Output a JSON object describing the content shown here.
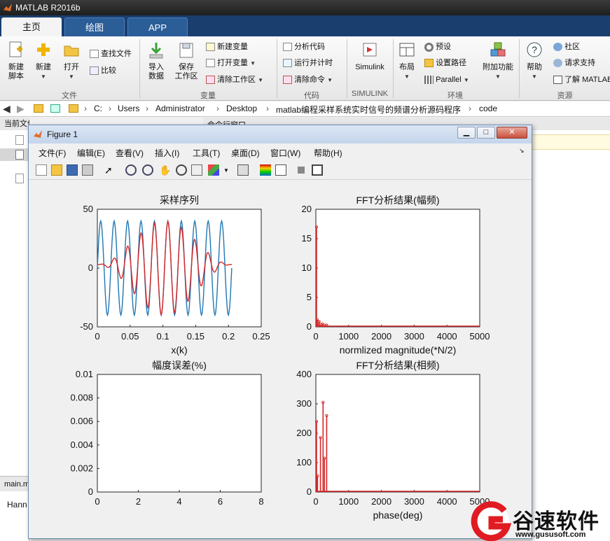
{
  "window": {
    "title": "MATLAB R2016b"
  },
  "tabs": [
    {
      "label": "主页"
    },
    {
      "label": "绘图"
    },
    {
      "label": "APP"
    }
  ],
  "ribbon": {
    "file": {
      "new_script": "新建\n脚本",
      "new": "新建",
      "open": "打开",
      "find_files": "查找文件",
      "compare": "比较",
      "group": "文件"
    },
    "variable": {
      "import": "导入\n数据",
      "save": "保存\n工作区",
      "new_var": "新建变量",
      "open_var": "打开变量",
      "clear_ws": "清除工作区",
      "group": "变量"
    },
    "code": {
      "analyze": "分析代码",
      "run_time": "运行并计时",
      "clear_cmd": "清除命令",
      "group": "代码"
    },
    "simulink": {
      "label": "Simulink",
      "group": "SIMULINK"
    },
    "env": {
      "layout": "布局",
      "prefs": "预设",
      "set_path": "设置路径",
      "parallel": "Parallel",
      "addons": "附加功能",
      "group": "环境"
    },
    "resources": {
      "help": "帮助",
      "community": "社区",
      "support": "请求支持",
      "learn": "了解 MATLAB",
      "group": "资源"
    }
  },
  "address": {
    "crumbs": [
      "C:",
      "Users",
      "Administrator",
      "Desktop",
      "matlab编程采样系统实时信号的频谱分析源码程序",
      "code"
    ]
  },
  "bg": {
    "current_folder": "当前文件夹",
    "cmd_window": "命令行窗口",
    "editor_tab": "main.m",
    "hann": "Hann"
  },
  "figure": {
    "title": "Figure 1",
    "menus": [
      "文件(F)",
      "编辑(E)",
      "查看(V)",
      "插入(I)",
      "工具(T)",
      "桌面(D)",
      "窗口(W)",
      "帮助(H)"
    ]
  },
  "colors": {
    "blue_series": "#1f77b4",
    "red_series": "#d62728",
    "tab_bg": "#1a3f6f"
  },
  "chart_data": [
    {
      "type": "line",
      "title": "采样序列",
      "xlabel": "x(k)",
      "ylabel": "",
      "xlim": [
        0,
        0.25
      ],
      "ylim": [
        -50,
        50
      ],
      "xticks": [
        "0",
        "0.05",
        "0.1",
        "0.15",
        "0.2",
        "0.25"
      ],
      "yticks": [
        "-50",
        "0",
        "50"
      ],
      "series": [
        {
          "color": "#1f77b4",
          "kind": "sine",
          "amplitude": 40,
          "cycles": 10,
          "xmax": 0.205
        },
        {
          "color": "#d62728",
          "kind": "windowed",
          "amplitude": 40,
          "cycles": 10,
          "xmax": 0.205
        }
      ]
    },
    {
      "type": "bar",
      "title": "FFT分析结果(幅频)",
      "xlabel": "normlized magnitude(*N/2)",
      "ylabel": "",
      "xlim": [
        0,
        5000
      ],
      "ylim": [
        0,
        20
      ],
      "xticks": [
        "0",
        "1000",
        "2000",
        "3000",
        "4000",
        "5000"
      ],
      "yticks": [
        "0",
        "5",
        "10",
        "15",
        "20"
      ],
      "stems": [
        [
          20,
          17
        ],
        [
          40,
          1.2
        ],
        [
          60,
          0.6
        ],
        [
          100,
          0.9
        ],
        [
          140,
          0.4
        ],
        [
          200,
          0.5
        ],
        [
          260,
          0.3
        ],
        [
          330,
          0.3
        ]
      ]
    },
    {
      "type": "line",
      "title": "幅度误差(%)",
      "xlabel": "",
      "ylabel": "",
      "xlim": [
        0,
        8
      ],
      "ylim": [
        0,
        0.01
      ],
      "xticks": [
        "0",
        "2",
        "4",
        "6",
        "8"
      ],
      "yticks": [
        "0",
        "0.002",
        "0.004",
        "0.006",
        "0.008",
        "0.01"
      ],
      "series": []
    },
    {
      "type": "bar",
      "title": "FFT分析结果(相频)",
      "xlabel": "phase(deg)",
      "ylabel": "",
      "xlim": [
        0,
        5000
      ],
      "ylim": [
        0,
        400
      ],
      "xticks": [
        "0",
        "1000",
        "2000",
        "3000",
        "4000",
        "5000"
      ],
      "yticks": [
        "0",
        "100",
        "200",
        "300",
        "400"
      ],
      "stems": [
        [
          20,
          240
        ],
        [
          50,
          55
        ],
        [
          140,
          185
        ],
        [
          220,
          305
        ],
        [
          260,
          115
        ],
        [
          330,
          260
        ]
      ]
    }
  ],
  "watermark": {
    "brand": "谷速软件",
    "url": "www.gususoft.com"
  }
}
